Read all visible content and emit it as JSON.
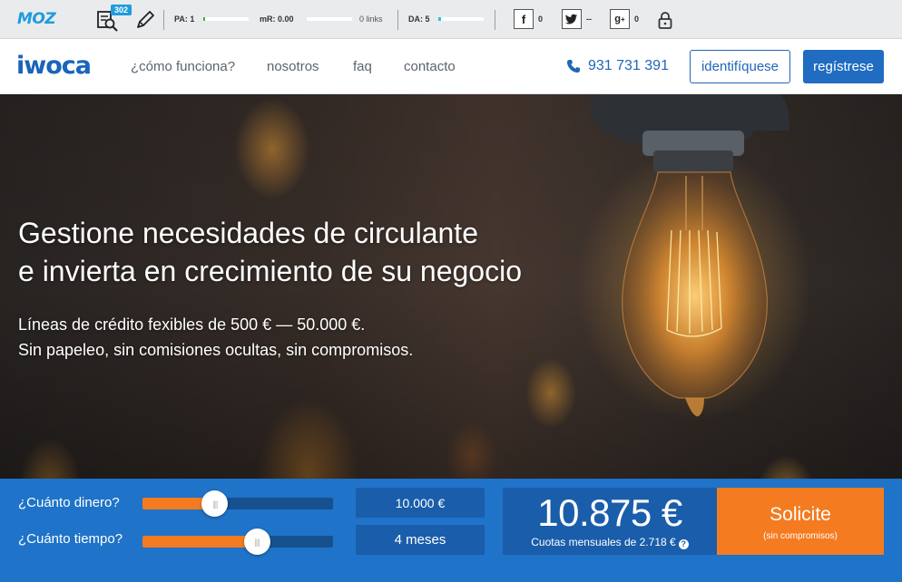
{
  "mozbar": {
    "logo": "MOZ",
    "badge_count": "302",
    "pa_label": "PA: 1",
    "pa_value": 1,
    "mr_label": "mR: 0.00",
    "links": "0 links",
    "da_label": "DA: 5",
    "da_value": 5,
    "facebook_count": "0",
    "twitter_count": "--",
    "gplus_count": "0",
    "accent_color": "#1f9bde"
  },
  "header": {
    "logo_text": "iwoca",
    "nav": [
      "¿cómo funciona?",
      "nosotros",
      "faq",
      "contacto"
    ],
    "phone": "931 731 391",
    "login_label": "identifíquese",
    "signup_label": "regístrese",
    "brand_color": "#1f66b8"
  },
  "hero": {
    "title_line1": "Gestione necesidades de circulante",
    "title_line2": "e invierta en crecimiento de su negocio",
    "sub_line1": "Líneas de crédito fexibles de 500 € — 50.000 €.",
    "sub_line2": "Sin papeleo, sin comisiones ocultas, sin compromisos."
  },
  "calculator": {
    "amount_label": "¿Cuánto dinero?",
    "amount_value": "10.000 €",
    "amount_slider_fraction": 0.38,
    "time_label": "¿Cuánto tiempo?",
    "time_value": "4 meses",
    "time_slider_fraction": 0.6,
    "total": "10.875 €",
    "monthly": "Cuotas mensuales de 2.718 €",
    "help_icon": "?",
    "cta_label": "Solicite",
    "cta_sub": "(sin compromisos)",
    "accent_color": "#f47b20"
  }
}
